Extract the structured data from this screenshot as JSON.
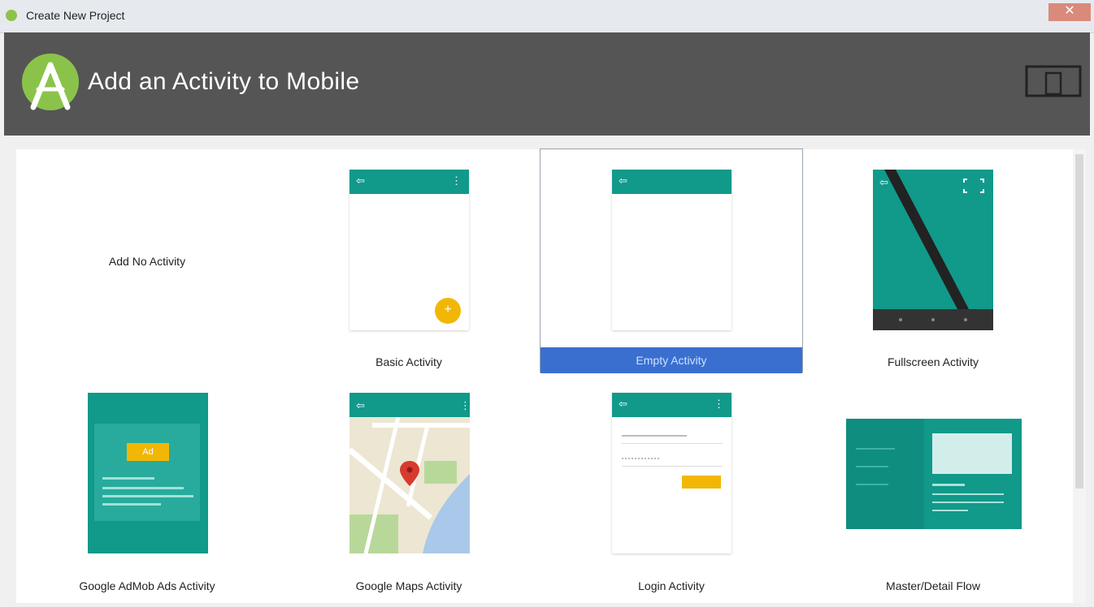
{
  "window": {
    "title": "Create New Project"
  },
  "header": {
    "title": "Add an Activity to Mobile",
    "logo_icon": "android-studio-icon",
    "device_icon": "phone-tablet-icon"
  },
  "colors": {
    "header_bg": "#555555",
    "accent_teal": "#11998a",
    "selection_blue": "#3a6fd0",
    "fab_yellow": "#f2b705",
    "map_pin_red": "#d83a2e"
  },
  "activities": [
    {
      "label": "Add No Activity",
      "selected": false
    },
    {
      "label": "Basic Activity",
      "selected": false
    },
    {
      "label": "Empty Activity",
      "selected": true
    },
    {
      "label": "Fullscreen Activity",
      "selected": false
    },
    {
      "label": "Google AdMob Ads Activity",
      "selected": false,
      "badge": "Ad"
    },
    {
      "label": "Google Maps Activity",
      "selected": false
    },
    {
      "label": "Login Activity",
      "selected": false
    },
    {
      "label": "Master/Detail Flow",
      "selected": false
    }
  ]
}
